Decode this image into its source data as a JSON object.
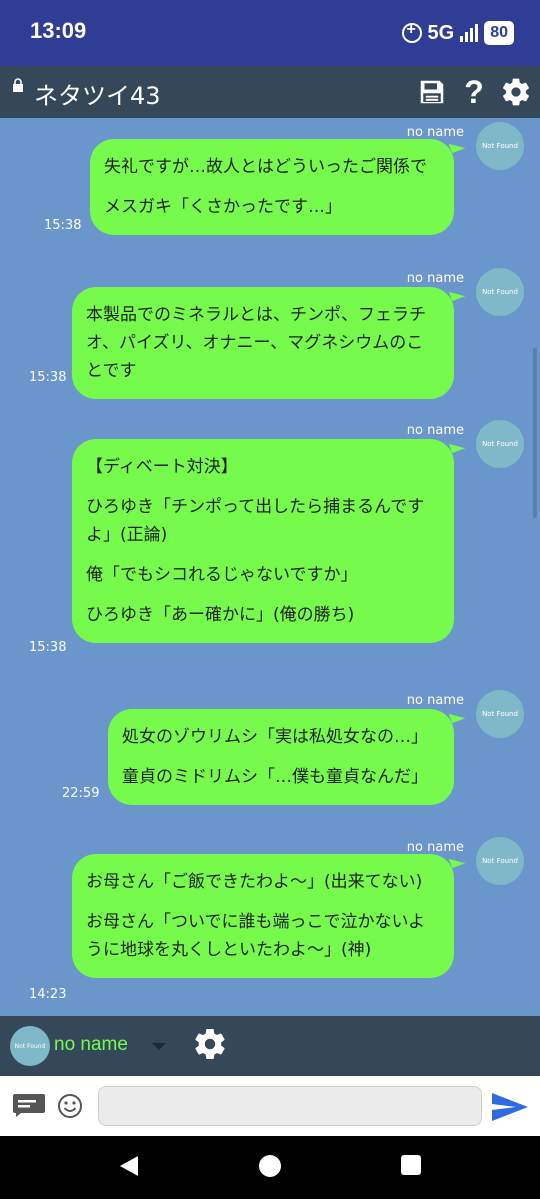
{
  "status": {
    "time": "13:09",
    "network": "5G",
    "battery": "80"
  },
  "header": {
    "title": "ネタツイ43"
  },
  "messages": [
    {
      "sender": "no name",
      "avatar_text": "Not Found",
      "lines": [
        "失礼ですが…故人とはどういったご関係で",
        "メスガキ「くさかったです…」"
      ],
      "time": "15:38"
    },
    {
      "sender": "no name",
      "avatar_text": "Not Found",
      "lines": [
        "本製品でのミネラルとは、チンポ、フェラチオ、パイズリ、オナニー、マグネシウムのことです"
      ],
      "time": "15:38"
    },
    {
      "sender": "no name",
      "avatar_text": "Not Found",
      "lines": [
        "【ディベート対決】",
        "ひろゆき「チンポって出したら捕まるんですよ」(正論)",
        "俺「でもシコれるじゃないですか」",
        "ひろゆき「あー確かに」(俺の勝ち)"
      ],
      "time": "15:38"
    },
    {
      "sender": "no name",
      "avatar_text": "Not Found",
      "lines": [
        "処女のゾウリムシ「実は私処女なの…」",
        "童貞のミドリムシ「…僕も童貞なんだ」"
      ],
      "time": "22:59"
    },
    {
      "sender": "no name",
      "avatar_text": "Not Found",
      "lines": [
        "お母さん「ご飯できたわよ〜」(出来てない)",
        "お母さん「ついでに誰も端っこで泣かないように地球を丸くしといたわよ〜」(神)"
      ],
      "time": "14:23"
    }
  ],
  "composer": {
    "sender_name": "no name",
    "avatar_text": "Not Found",
    "input_value": ""
  },
  "colors": {
    "status_bar": "#2f3d95",
    "app_bar": "#34485a",
    "chat_background": "#6a96cc",
    "bubble": "#76fb4d",
    "avatar": "#7fb8c8"
  }
}
